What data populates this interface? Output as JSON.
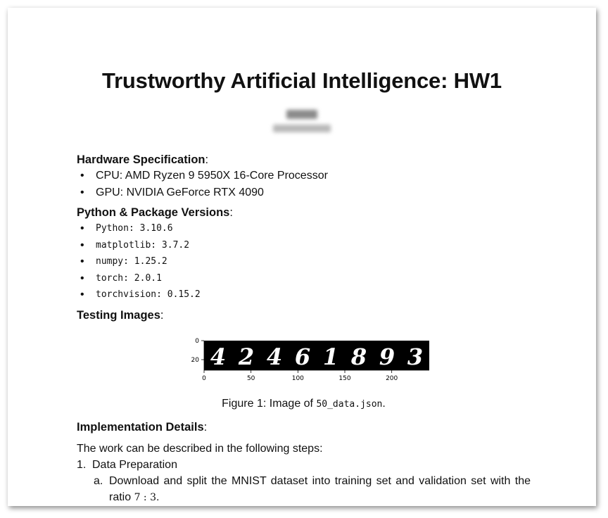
{
  "title": "Trustworthy Artificial Intelligence: HW1",
  "hardware": {
    "heading": "Hardware Specification",
    "items": [
      "CPU: AMD Ryzen 9 5950X 16-Core Processor",
      "GPU: NVIDIA GeForce RTX 4090"
    ]
  },
  "versions": {
    "heading": "Python & Package Versions",
    "items": [
      "Python: 3.10.6",
      "matplotlib: 3.7.2",
      "numpy: 1.25.2",
      "torch: 2.0.1",
      "torchvision: 0.15.2"
    ]
  },
  "testing": {
    "heading": "Testing Images",
    "figure": {
      "digits": [
        "4",
        "2",
        "4",
        "6",
        "1",
        "8",
        "9",
        "3"
      ],
      "x_ticks": [
        "0",
        "50",
        "100",
        "150",
        "200"
      ],
      "y_ticks": [
        "0",
        "20"
      ]
    },
    "caption_prefix": "Figure 1: Image of ",
    "caption_code": "50_data.json",
    "caption_suffix": "."
  },
  "implementation": {
    "heading": "Implementation Details",
    "intro": "The work can be described in the following steps:",
    "steps": [
      {
        "num": "1.",
        "label": "Data Preparation",
        "substeps": [
          {
            "num": "a.",
            "text_before": "Download and split the MNIST dataset into training set and validation set with the ratio ",
            "math": "7 : 3",
            "text_after": "."
          }
        ]
      }
    ]
  }
}
